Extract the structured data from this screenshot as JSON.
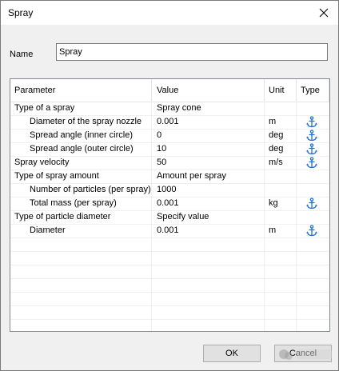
{
  "window": {
    "title": "Spray"
  },
  "name_field": {
    "label": "Name",
    "value": "Spray"
  },
  "table": {
    "headers": {
      "parameter": "Parameter",
      "value": "Value",
      "unit": "Unit",
      "type": "Type"
    },
    "rows": [
      {
        "parameter": "Type of a spray",
        "value": "Spray cone",
        "unit": "",
        "indent": 0,
        "anchor": false
      },
      {
        "parameter": "Diameter of the spray nozzle",
        "value": "0.001",
        "unit": "m",
        "indent": 1,
        "anchor": true
      },
      {
        "parameter": "Spread angle (inner circle)",
        "value": "0",
        "unit": "deg",
        "indent": 1,
        "anchor": true
      },
      {
        "parameter": "Spread angle (outer circle)",
        "value": "10",
        "unit": "deg",
        "indent": 1,
        "anchor": true
      },
      {
        "parameter": "Spray velocity",
        "value": "50",
        "unit": "m/s",
        "indent": 0,
        "anchor": true
      },
      {
        "parameter": "Type of spray amount",
        "value": "Amount per spray",
        "unit": "",
        "indent": 0,
        "anchor": false
      },
      {
        "parameter": "Number of particles (per spray)",
        "value": "1000",
        "unit": "",
        "indent": 1,
        "anchor": false
      },
      {
        "parameter": "Total mass (per spray)",
        "value": "0.001",
        "unit": "kg",
        "indent": 1,
        "anchor": true
      },
      {
        "parameter": "Type of particle diameter",
        "value": "Specify value",
        "unit": "",
        "indent": 0,
        "anchor": false
      },
      {
        "parameter": "Diameter",
        "value": "0.001",
        "unit": "m",
        "indent": 1,
        "anchor": true
      }
    ],
    "empty_rows": 7
  },
  "buttons": {
    "ok": "OK",
    "cancel": "Cancel"
  },
  "icons": {
    "anchor": "anchor-icon",
    "close": "close-icon"
  },
  "colors": {
    "anchor": "#1f6fd1",
    "table_border": "#828790"
  }
}
